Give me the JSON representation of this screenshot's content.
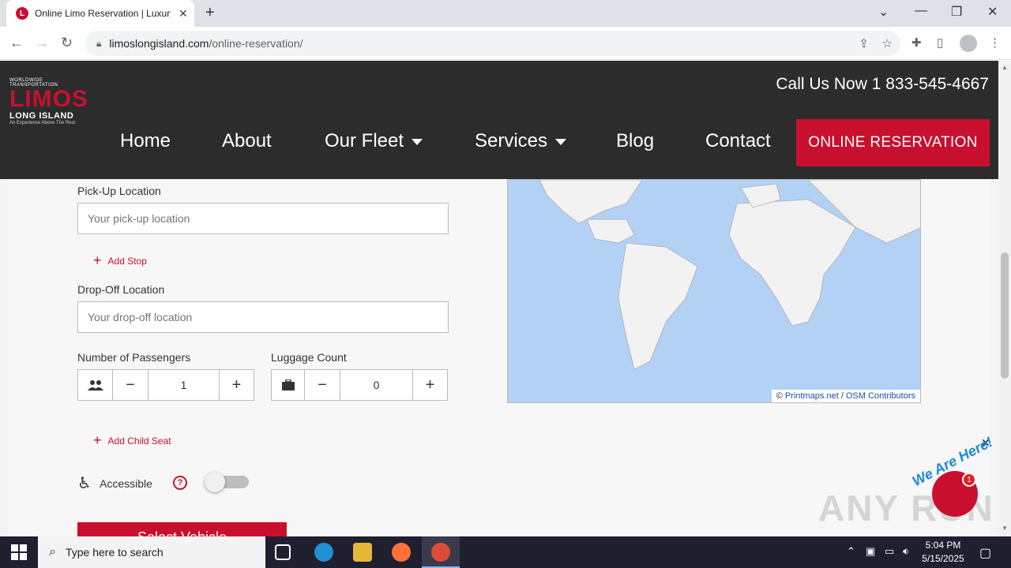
{
  "browser": {
    "tab_title": "Online Limo Reservation | Luxury",
    "url_domain": "limoslongisland.com",
    "url_path": "/online-reservation/"
  },
  "header": {
    "logo_top": "WORLDWIDE TRANSPORTATION",
    "logo_main": "LIMOS",
    "logo_sub": "LONG ISLAND",
    "logo_tag": "An Experience Above The Rest",
    "phone": "Call Us Now 1 833-545-4667",
    "nav": [
      "Home",
      "About",
      "Our Fleet",
      "Services",
      "Blog",
      "Contact"
    ],
    "cta": "ONLINE RESERVATION"
  },
  "form": {
    "pickup_label": "Pick-Up Location",
    "pickup_placeholder": "Your pick-up location",
    "add_stop": "Add Stop",
    "dropoff_label": "Drop-Off Location",
    "dropoff_placeholder": "Your drop-off location",
    "passengers_label": "Number of Passengers",
    "passengers_value": "1",
    "luggage_label": "Luggage Count",
    "luggage_value": "0",
    "add_child_seat": "Add Child Seat",
    "accessible_label": "Accessible",
    "accessible_on": false,
    "select_vehicle": "Select Vehicle"
  },
  "map": {
    "attribution_symbol": "©",
    "attribution_link1": "Printmaps.net",
    "attribution_sep": "/",
    "attribution_link2": "OSM Contributors"
  },
  "overlay": {
    "watermark": "ANY RUN",
    "chat_label": "We Are Here!",
    "chat_badge": "1"
  },
  "taskbar": {
    "search_placeholder": "Type here to search",
    "time": "5:04 PM",
    "date": "5/15/2025"
  },
  "colors": {
    "brand_red": "#c8102e",
    "header_bg": "#2c2c2c",
    "map_water": "#b3d1f5"
  }
}
